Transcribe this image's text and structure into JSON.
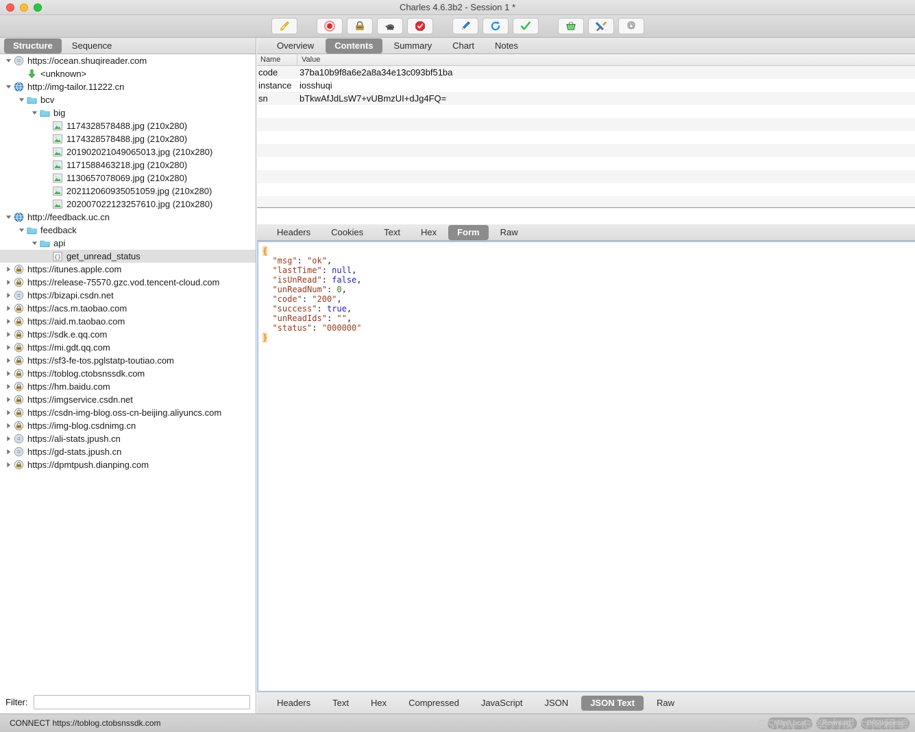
{
  "window": {
    "title": "Charles 4.6.3b2 - Session 1 *",
    "traffic_lights": [
      "close",
      "minimize",
      "zoom"
    ]
  },
  "toolbar": {
    "buttons": [
      {
        "name": "clear-session-icon",
        "label": "Clear Session"
      },
      {
        "name": "record-icon",
        "label": "Start/Stop Recording"
      },
      {
        "name": "ssl-proxying-icon",
        "label": "SSL Proxying"
      },
      {
        "name": "throttle-icon",
        "label": "Start/Stop Throttling"
      },
      {
        "name": "breakpoints-icon",
        "label": "Enable/Disable Breakpoints"
      },
      {
        "name": "compose-icon",
        "label": "Compose"
      },
      {
        "name": "repeat-icon",
        "label": "Repeat"
      },
      {
        "name": "validate-icon",
        "label": "Validate"
      },
      {
        "name": "tools-basket-icon",
        "label": "Tools"
      },
      {
        "name": "tools-icon",
        "label": "Tools"
      },
      {
        "name": "settings-gear-icon",
        "label": "Settings"
      }
    ]
  },
  "left_panel": {
    "tabs": [
      {
        "label": "Structure",
        "selected": true
      },
      {
        "label": "Sequence",
        "selected": false
      }
    ],
    "tree": [
      {
        "label": "https://ocean.shuqireader.com",
        "indent": 0,
        "icon": "globe-secure-icon",
        "twisty": "down"
      },
      {
        "label": "<unknown>",
        "indent": 1,
        "icon": "green-down-arrow-icon",
        "twisty": "none"
      },
      {
        "label": "http://img-tailor.11222.cn",
        "indent": 0,
        "icon": "globe-blue-icon",
        "twisty": "down"
      },
      {
        "label": "bcv",
        "indent": 1,
        "icon": "folder-icon",
        "twisty": "down"
      },
      {
        "label": "big",
        "indent": 2,
        "icon": "folder-icon",
        "twisty": "down"
      },
      {
        "label": "1174328578488.jpg (210x280)",
        "indent": 3,
        "icon": "image-icon",
        "twisty": "none"
      },
      {
        "label": "1174328578488.jpg (210x280)",
        "indent": 3,
        "icon": "image-icon",
        "twisty": "none"
      },
      {
        "label": "201902021049065013.jpg (210x280)",
        "indent": 3,
        "icon": "image-icon",
        "twisty": "none"
      },
      {
        "label": "1171588463218.jpg (210x280)",
        "indent": 3,
        "icon": "image-icon",
        "twisty": "none"
      },
      {
        "label": "1130657078069.jpg (210x280)",
        "indent": 3,
        "icon": "image-icon",
        "twisty": "none"
      },
      {
        "label": "202112060935051059.jpg (210x280)",
        "indent": 3,
        "icon": "image-icon",
        "twisty": "none"
      },
      {
        "label": "202007022123257610.jpg (210x280)",
        "indent": 3,
        "icon": "image-icon",
        "twisty": "none"
      },
      {
        "label": "http://feedback.uc.cn",
        "indent": 0,
        "icon": "globe-blue-icon",
        "twisty": "down"
      },
      {
        "label": "feedback",
        "indent": 1,
        "icon": "folder-icon",
        "twisty": "down"
      },
      {
        "label": "api",
        "indent": 2,
        "icon": "folder-icon",
        "twisty": "down"
      },
      {
        "label": "get_unread_status",
        "indent": 3,
        "icon": "json-icon",
        "twisty": "none",
        "selected": true
      },
      {
        "label": "https://itunes.apple.com",
        "indent": 0,
        "icon": "globe-lock-icon",
        "twisty": "right"
      },
      {
        "label": "https://release-75570.gzc.vod.tencent-cloud.com",
        "indent": 0,
        "icon": "globe-lock-icon",
        "twisty": "right"
      },
      {
        "label": "https://bizapi.csdn.net",
        "indent": 0,
        "icon": "globe-secure-icon",
        "twisty": "right"
      },
      {
        "label": "https://acs.m.taobao.com",
        "indent": 0,
        "icon": "globe-lock-icon",
        "twisty": "right"
      },
      {
        "label": "https://aid.m.taobao.com",
        "indent": 0,
        "icon": "globe-lock-icon",
        "twisty": "right"
      },
      {
        "label": "https://sdk.e.qq.com",
        "indent": 0,
        "icon": "globe-lock-icon",
        "twisty": "right"
      },
      {
        "label": "https://mi.gdt.qq.com",
        "indent": 0,
        "icon": "globe-lock-icon",
        "twisty": "right"
      },
      {
        "label": "https://sf3-fe-tos.pglstatp-toutiao.com",
        "indent": 0,
        "icon": "globe-lock-icon",
        "twisty": "right"
      },
      {
        "label": "https://toblog.ctobsnssdk.com",
        "indent": 0,
        "icon": "globe-lock-icon",
        "twisty": "right"
      },
      {
        "label": "https://hm.baidu.com",
        "indent": 0,
        "icon": "globe-lock-icon",
        "twisty": "right"
      },
      {
        "label": "https://imgservice.csdn.net",
        "indent": 0,
        "icon": "globe-lock-icon",
        "twisty": "right"
      },
      {
        "label": "https://csdn-img-blog.oss-cn-beijing.aliyuncs.com",
        "indent": 0,
        "icon": "globe-lock-icon",
        "twisty": "right"
      },
      {
        "label": "https://img-blog.csdnimg.cn",
        "indent": 0,
        "icon": "globe-lock-icon",
        "twisty": "right"
      },
      {
        "label": "https://ali-stats.jpush.cn",
        "indent": 0,
        "icon": "globe-secure-icon",
        "twisty": "right"
      },
      {
        "label": "https://gd-stats.jpush.cn",
        "indent": 0,
        "icon": "globe-secure-icon",
        "twisty": "right"
      },
      {
        "label": "https://dpmtpush.dianping.com",
        "indent": 0,
        "icon": "globe-lock-icon",
        "twisty": "right"
      }
    ],
    "filter": {
      "label": "Filter:",
      "value": "",
      "placeholder": ""
    }
  },
  "right_panel": {
    "tabs": [
      {
        "label": "Overview",
        "selected": false
      },
      {
        "label": "Contents",
        "selected": true
      },
      {
        "label": "Summary",
        "selected": false
      },
      {
        "label": "Chart",
        "selected": false
      },
      {
        "label": "Notes",
        "selected": false
      }
    ],
    "table": {
      "columns": [
        "Name",
        "Value"
      ],
      "rows": [
        {
          "name": "code",
          "value": "37ba10b9f8a6e2a8a34e13c093bf51ba"
        },
        {
          "name": "instance",
          "value": "iosshuqi"
        },
        {
          "name": "sn",
          "value": "bTkwAfJdLsW7+vUBmzUI+dJg4FQ="
        }
      ],
      "empty_row_count": 9
    },
    "request_tabs": [
      {
        "label": "Headers",
        "selected": false
      },
      {
        "label": "Cookies",
        "selected": false
      },
      {
        "label": "Text",
        "selected": false
      },
      {
        "label": "Hex",
        "selected": false
      },
      {
        "label": "Form",
        "selected": true
      },
      {
        "label": "Raw",
        "selected": false
      }
    ],
    "json_body": {
      "open_brace": "{",
      "close_brace": "}",
      "entries": [
        {
          "key": "\"msg\"",
          "value": "\"ok\"",
          "type": "string",
          "comma": ","
        },
        {
          "key": "\"lastTime\"",
          "value": "null",
          "type": "keyword",
          "comma": ","
        },
        {
          "key": "\"isUnRead\"",
          "value": "false",
          "type": "keyword",
          "comma": ","
        },
        {
          "key": "\"unReadNum\"",
          "value": "0",
          "type": "number",
          "comma": ","
        },
        {
          "key": "\"code\"",
          "value": "\"200\"",
          "type": "string",
          "comma": ","
        },
        {
          "key": "\"success\"",
          "value": "true",
          "type": "keyword",
          "comma": ","
        },
        {
          "key": "\"unReadIds\"",
          "value": "\"\"",
          "type": "string",
          "comma": ","
        },
        {
          "key": "\"status\"",
          "value": "\"000000\"",
          "type": "string",
          "comma": ""
        }
      ]
    }
  },
  "bottom_tabs": [
    {
      "label": "Headers",
      "selected": false
    },
    {
      "label": "Text",
      "selected": false
    },
    {
      "label": "Hex",
      "selected": false
    },
    {
      "label": "Compressed",
      "selected": false
    },
    {
      "label": "JavaScript",
      "selected": false
    },
    {
      "label": "JSON",
      "selected": false
    },
    {
      "label": "JSON Text",
      "selected": true
    },
    {
      "label": "Raw",
      "selected": false
    }
  ],
  "statusbar": {
    "text": "CONNECT https://toblog.ctobsnssdk.com",
    "pills": [
      "Map Local",
      "Rewriting",
      "Breakpoints"
    ],
    "watermark": "CSDN @努力成为包租婆"
  },
  "colors": {
    "selection": "#dfdfdf",
    "tab_selected_bg": "#8c8c8c",
    "accent_border": "#a9c4e8",
    "json_key": "#9a3b1b",
    "json_keyword": "#2020cc",
    "json_number": "#3c7a1e",
    "json_brace_bg": "#ffd9a0"
  }
}
